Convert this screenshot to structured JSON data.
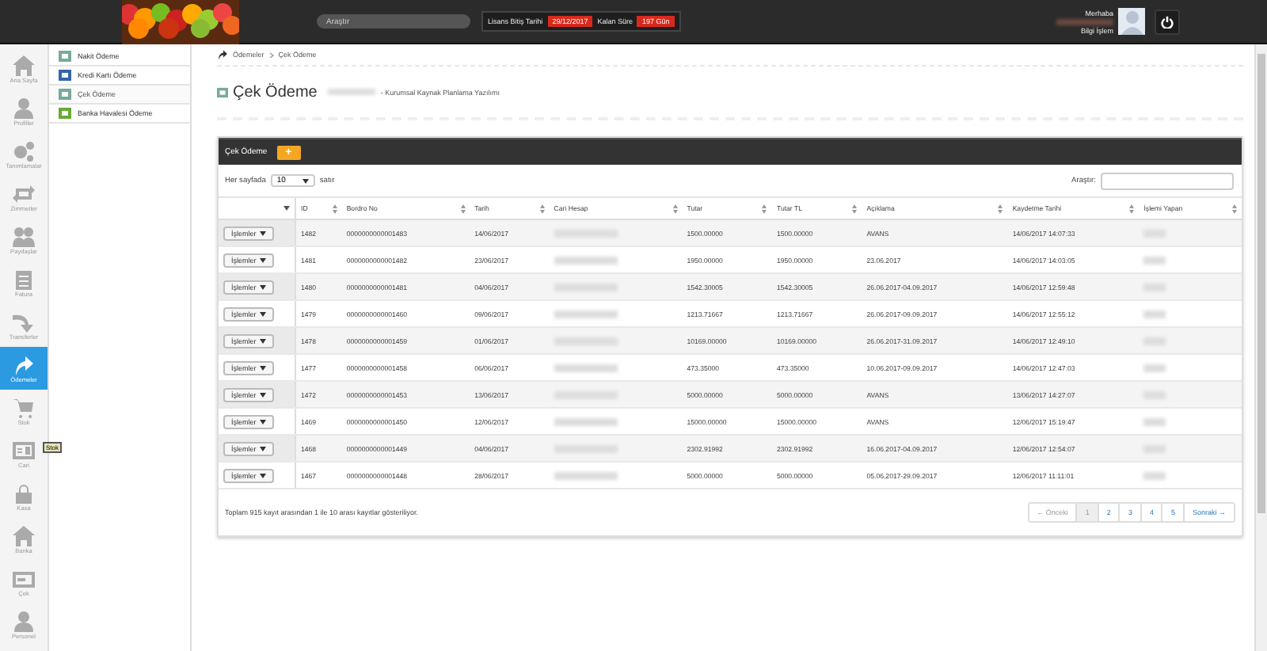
{
  "header": {
    "search": {
      "placeholder": "Araştır"
    },
    "license_label": "Lisans Bitiş Tarihi",
    "license_date": "29/12/2017",
    "remaining_label": "Kalan Süre",
    "remaining_value": "197 Gün",
    "greeting": "Merhaba",
    "department": "Bilgi İşlem"
  },
  "nav": [
    {
      "label": "Ana Sayfa",
      "selected": false
    },
    {
      "label": "Profiller",
      "selected": false
    },
    {
      "label": "Tanımlamalar",
      "selected": false
    },
    {
      "label": "Zimmetler",
      "selected": false
    },
    {
      "label": "Paydaşlar",
      "selected": false
    },
    {
      "label": "Fatura",
      "selected": false
    },
    {
      "label": "Transferler",
      "selected": false
    },
    {
      "label": "Ödemeler",
      "selected": true
    },
    {
      "label": "Stok",
      "selected": false
    },
    {
      "label": "Cari",
      "selected": false
    },
    {
      "label": "Kasa",
      "selected": false
    },
    {
      "label": "Banka",
      "selected": false
    },
    {
      "label": "Çek",
      "selected": false
    },
    {
      "label": "Personel",
      "selected": false
    }
  ],
  "tooltip": "Stok",
  "submenu": [
    {
      "label": "Nakit Ödeme",
      "selected": false
    },
    {
      "label": "Kredi Kartı Ödeme",
      "selected": false
    },
    {
      "label": "Çek Ödeme",
      "selected": true
    },
    {
      "label": "Banka Havalesi Ödeme",
      "selected": false
    }
  ],
  "breadcrumb": [
    "Ödemeler",
    "Çek Ödeme"
  ],
  "page_title": "Çek Ödeme",
  "page_subtitle": "- Kurumsal Kaynak Planlama Yazılımı",
  "panel": {
    "title": "Çek Ödeme",
    "add_button": "+",
    "page_size_label": "Her sayfada",
    "page_size": "10",
    "page_size_suffix": "satır",
    "search_label": "Araştır:"
  },
  "table": {
    "columns": [
      "",
      "ID",
      "Bordro No",
      "Tarih",
      "Cari Hesap",
      "Tutar",
      "Tutar TL",
      "Açıklama",
      "Kaydetme Tarihi",
      "İşlemi Yapan"
    ],
    "rows": [
      [
        "İşlemler",
        "1482",
        "0000000000001483",
        "14/06/2017",
        "",
        "1500.00000",
        "1500.00000",
        "AVANS",
        "14/06/2017 14:07:33",
        ""
      ],
      [
        "İşlemler",
        "1481",
        "0000000000001482",
        "23/06/2017",
        "",
        "1950.00000",
        "1950.00000",
        "23.06.2017",
        "14/06/2017 14:03:05",
        ""
      ],
      [
        "İşlemler",
        "1480",
        "0000000000001481",
        "04/06/2017",
        "",
        "1542.30005",
        "1542.30005",
        "26.06.2017-04.09.2017",
        "14/06/2017 12:59:48",
        ""
      ],
      [
        "İşlemler",
        "1479",
        "0000000000001460",
        "09/06/2017",
        "",
        "1213.71667",
        "1213.71667",
        "26.06.2017-09.09.2017",
        "14/06/2017 12:55:12",
        ""
      ],
      [
        "İşlemler",
        "1478",
        "0000000000001459",
        "01/06/2017",
        "",
        "10169.00000",
        "10169.00000",
        "26.06.2017-31.09.2017",
        "14/06/2017 12:49:10",
        ""
      ],
      [
        "İşlemler",
        "1477",
        "0000000000001458",
        "06/06/2017",
        "",
        "473.35000",
        "473.35000",
        "10.06.2017-09.09.2017",
        "14/06/2017 12:47:03",
        ""
      ],
      [
        "İşlemler",
        "1472",
        "0000000000001453",
        "13/06/2017",
        "",
        "5000.00000",
        "5000.00000",
        "AVANS",
        "13/06/2017 14:27:07",
        ""
      ],
      [
        "İşlemler",
        "1469",
        "0000000000001450",
        "12/06/2017",
        "",
        "15000.00000",
        "15000.00000",
        "AVANS",
        "12/06/2017 15:19:47",
        ""
      ],
      [
        "İşlemler",
        "1468",
        "0000000000001449",
        "04/06/2017",
        "",
        "2302.91992",
        "2302.91992",
        "16.06.2017-04.09.2017",
        "12/06/2017 12:54:07",
        ""
      ],
      [
        "İşlemler",
        "1467",
        "0000000000001448",
        "28/06/2017",
        "",
        "5000.00000",
        "5000.00000",
        "05.06.2017-29.09.2017",
        "12/06/2017 11:11:01",
        ""
      ]
    ]
  },
  "summary": "Toplam 915 kayıt arasından 1 ile 10 arası kayıtlar gösteriliyor.",
  "pagination": [
    {
      "label": "← Önceki",
      "kind": "prev",
      "selected": false
    },
    {
      "label": "1",
      "kind": "page",
      "selected": true
    },
    {
      "label": "2",
      "kind": "page",
      "selected": false
    },
    {
      "label": "3",
      "kind": "page",
      "selected": false
    },
    {
      "label": "4",
      "kind": "page",
      "selected": false
    },
    {
      "label": "5",
      "kind": "page",
      "selected": false
    },
    {
      "label": "Sonraki →",
      "kind": "next",
      "selected": false
    }
  ]
}
